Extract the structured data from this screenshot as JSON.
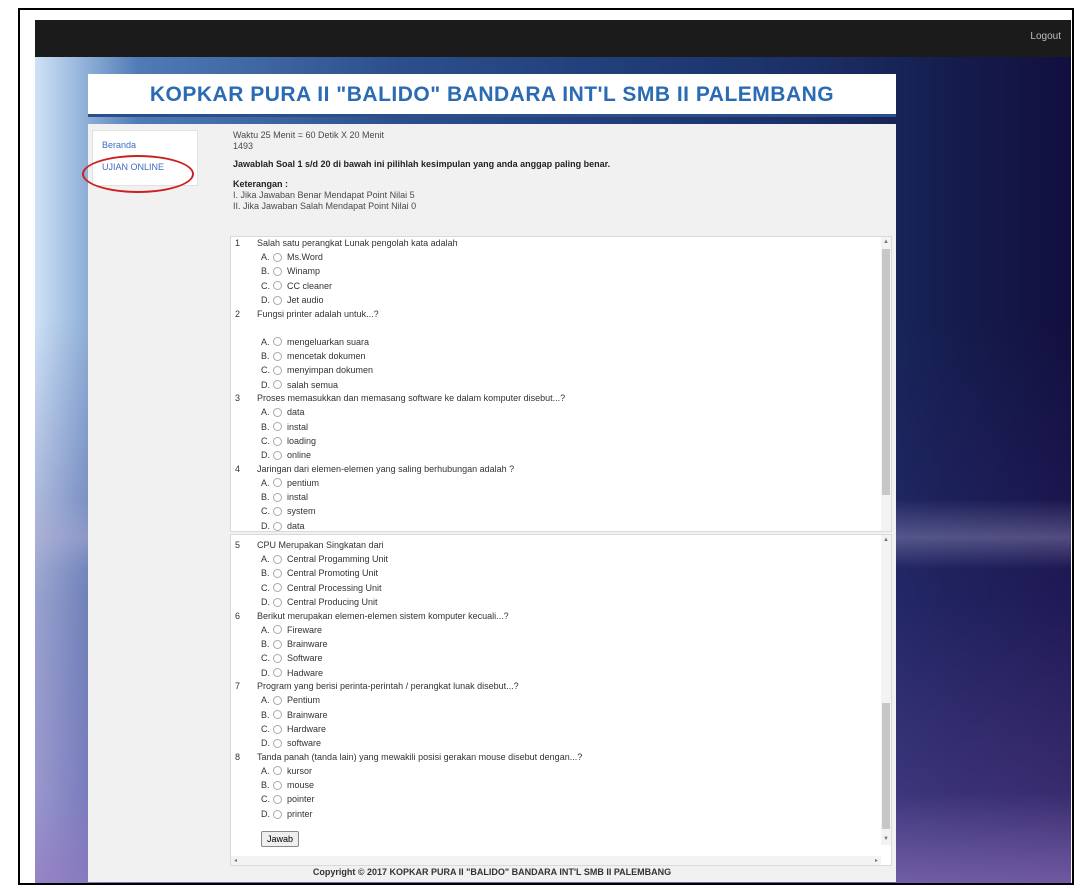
{
  "topbar": {
    "logout_label": "Logout"
  },
  "header": {
    "site_title": "KOPKAR PURA II \"BALIDO\" BANDARA INT'L SMB II PALEMBANG"
  },
  "sidebar": {
    "items": [
      {
        "label": "Beranda"
      },
      {
        "label": "UJIAN ONLINE"
      }
    ]
  },
  "exam": {
    "time_info": "Waktu 25 Menit = 60 Detik X 20 Menit",
    "code": "1493",
    "instruction": "Jawablah Soal 1 s/d 20 di bawah ini pilihlah kesimpulan yang anda anggap paling benar.",
    "keterangan_title": "Keterangan :",
    "keterangan_1": "I. Jika Jawaban Benar Mendapat Point Nilai 5",
    "keterangan_2": "II. Jika Jawaban Salah Mendapat Point Nilai 0"
  },
  "questions": [
    {
      "num": "1",
      "text": "Salah satu perangkat Lunak pengolah kata adalah",
      "options": [
        {
          "letter": "A.",
          "text": "Ms.Word"
        },
        {
          "letter": "B.",
          "text": "Winamp"
        },
        {
          "letter": "C.",
          "text": "CC cleaner"
        },
        {
          "letter": "D.",
          "text": "Jet audio"
        }
      ]
    },
    {
      "num": "2",
      "text": "Fungsi printer adalah untuk...?",
      "options": [
        {
          "letter": "A.",
          "text": "mengeluarkan suara"
        },
        {
          "letter": "B.",
          "text": "mencetak dokumen"
        },
        {
          "letter": "C.",
          "text": "menyimpan dokumen"
        },
        {
          "letter": "D.",
          "text": "salah semua"
        }
      ]
    },
    {
      "num": "3",
      "text": "Proses memasukkan dan memasang software ke dalam komputer disebut...?",
      "options": [
        {
          "letter": "A.",
          "text": "data"
        },
        {
          "letter": "B.",
          "text": "instal"
        },
        {
          "letter": "C.",
          "text": "loading"
        },
        {
          "letter": "D.",
          "text": "online"
        }
      ]
    },
    {
      "num": "4",
      "text": "Jaringan dari elemen-elemen yang saling berhubungan adalah ?",
      "options": [
        {
          "letter": "A.",
          "text": "pentium"
        },
        {
          "letter": "B.",
          "text": "instal"
        },
        {
          "letter": "C.",
          "text": "system"
        },
        {
          "letter": "D.",
          "text": "data"
        }
      ]
    },
    {
      "num": "5",
      "text": "CPU Merupakan Singkatan dari",
      "options": [
        {
          "letter": "A.",
          "text": "Central Progamming Unit"
        },
        {
          "letter": "B.",
          "text": "Central Promoting Unit"
        },
        {
          "letter": "C.",
          "text": "Central Processing Unit"
        },
        {
          "letter": "D.",
          "text": "Central Producing Unit"
        }
      ]
    },
    {
      "num": "6",
      "text": "Berikut merupakan elemen-elemen sistem komputer kecuali...?",
      "options": [
        {
          "letter": "A.",
          "text": "Fireware"
        },
        {
          "letter": "B.",
          "text": "Brainware"
        },
        {
          "letter": "C.",
          "text": "Software"
        },
        {
          "letter": "D.",
          "text": "Hadware"
        }
      ]
    },
    {
      "num": "7",
      "text": "Program yang berisi perinta-perintah / perangkat lunak disebut...?",
      "options": [
        {
          "letter": "A.",
          "text": "Pentium"
        },
        {
          "letter": "B.",
          "text": "Brainware"
        },
        {
          "letter": "C.",
          "text": "Hardware"
        },
        {
          "letter": "D.",
          "text": "software"
        }
      ]
    },
    {
      "num": "8",
      "text": "Tanda panah (tanda lain) yang mewakili posisi gerakan mouse disebut dengan...?",
      "options": [
        {
          "letter": "A.",
          "text": "kursor"
        },
        {
          "letter": "B.",
          "text": "mouse"
        },
        {
          "letter": "C.",
          "text": "pointer"
        },
        {
          "letter": "D.",
          "text": "printer"
        }
      ]
    }
  ],
  "actions": {
    "submit_label": "Jawab"
  },
  "footer": {
    "copyright": "Copyright © 2017 KOPKAR PURA II \"BALIDO\" BANDARA INT'L SMB II PALEMBANG"
  },
  "colors": {
    "title": "#2a6bb3",
    "nav_link": "#3d6ec0",
    "highlight": "#cc1f1f",
    "topbar": "#1b1b1b"
  }
}
